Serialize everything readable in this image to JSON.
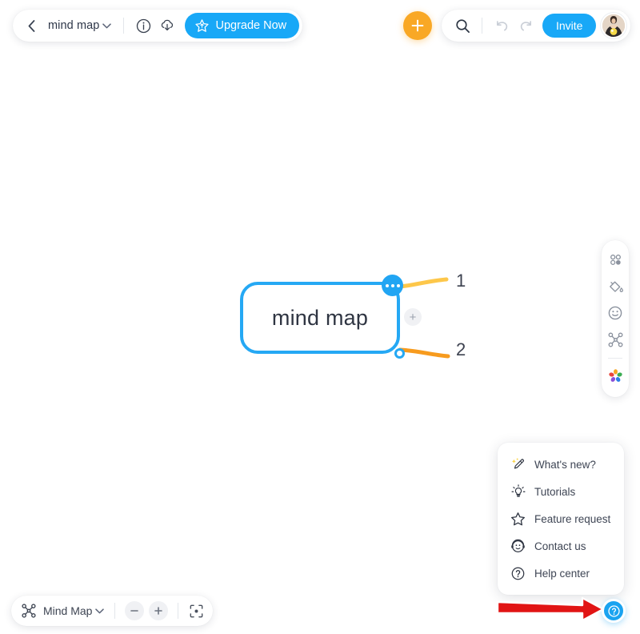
{
  "document": {
    "back_icon": "chevron-left-icon",
    "title": "mind map",
    "caret_icon": "chevron-down-icon",
    "info_icon": "info-circle-icon",
    "download_icon": "cloud-download-icon",
    "upgrade_label": "Upgrade Now",
    "upgrade_icon": "star-badge-icon",
    "upgrade_color": "#18a8f7"
  },
  "toolbar": {
    "add_icon": "plus-icon",
    "add_color": "#f9a825",
    "search_icon": "search-icon",
    "undo_icon": "undo-arrow-icon",
    "redo_icon": "redo-arrow-icon",
    "invite_label": "Invite",
    "invite_color": "#18a8f7",
    "avatar_icon": "user-avatar"
  },
  "canvas": {
    "root_node": {
      "label": "mind map",
      "border_color": "#25A8F4",
      "menu_icon": "more-dots-icon",
      "handle_icon": "connector-handle",
      "add_child_icon": "plus-icon"
    },
    "branches": [
      {
        "label": "1",
        "color": "#FDC74A"
      },
      {
        "label": "2",
        "color": "#F79B1E"
      }
    ]
  },
  "side_toolbar": {
    "items": [
      {
        "icon": "layout-dots-icon",
        "name": "layout"
      },
      {
        "icon": "paint-bucket-icon",
        "name": "theme"
      },
      {
        "icon": "emoji-smiley-icon",
        "name": "emoji"
      },
      {
        "icon": "mindmap-cluster-icon",
        "name": "structure"
      },
      {
        "icon": "color-palette-flower-icon",
        "name": "palette"
      }
    ]
  },
  "help_menu": {
    "items": [
      {
        "label": "What's new?",
        "icon": "magic-pen-icon"
      },
      {
        "label": "Tutorials",
        "icon": "lightbulb-icon"
      },
      {
        "label": "Feature request",
        "icon": "star-outline-icon"
      },
      {
        "label": "Contact us",
        "icon": "headset-face-icon"
      },
      {
        "label": "Help center",
        "icon": "question-circle-icon"
      }
    ]
  },
  "bottom_bar": {
    "mode_icon": "mindmap-cluster-icon",
    "mode_label": "Mind Map",
    "mode_caret_icon": "chevron-down-icon",
    "zoom_out_icon": "minus-icon",
    "zoom_in_icon": "plus-icon",
    "fit_icon": "fit-to-screen-icon"
  },
  "help_fab": {
    "icon": "question-circle-icon",
    "color": "#1aa3f0"
  },
  "annotation": {
    "arrow_icon": "red-arrow-pointer",
    "color": "#e11414"
  }
}
